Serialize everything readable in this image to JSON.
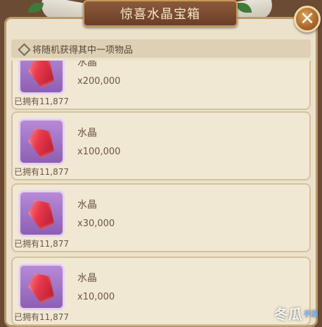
{
  "title": "惊喜水晶宝箱",
  "subtitle": "将随机获得其中一项物品",
  "icons": {
    "close": "close-icon",
    "diamond": "diamond-icon",
    "crystal": "crystal-icon"
  },
  "colors": {
    "panel_bg": "#ece2cc",
    "title_plate": "#7a4b30",
    "item_icon_bg": "#a374c6",
    "crystal": "#e83a4c",
    "text": "#6b5644"
  },
  "items": [
    {
      "name": "水晶",
      "quantity": "x200,000",
      "owned": "已拥有11,877"
    },
    {
      "name": "水晶",
      "quantity": "x100,000",
      "owned": "已拥有11,877"
    },
    {
      "name": "水晶",
      "quantity": "x30,000",
      "owned": "已拥有11,877"
    },
    {
      "name": "水晶",
      "quantity": "x10,000",
      "owned": "已拥有11,877"
    }
  ],
  "watermark": {
    "main": "冬瓜",
    "sub": "手游"
  }
}
